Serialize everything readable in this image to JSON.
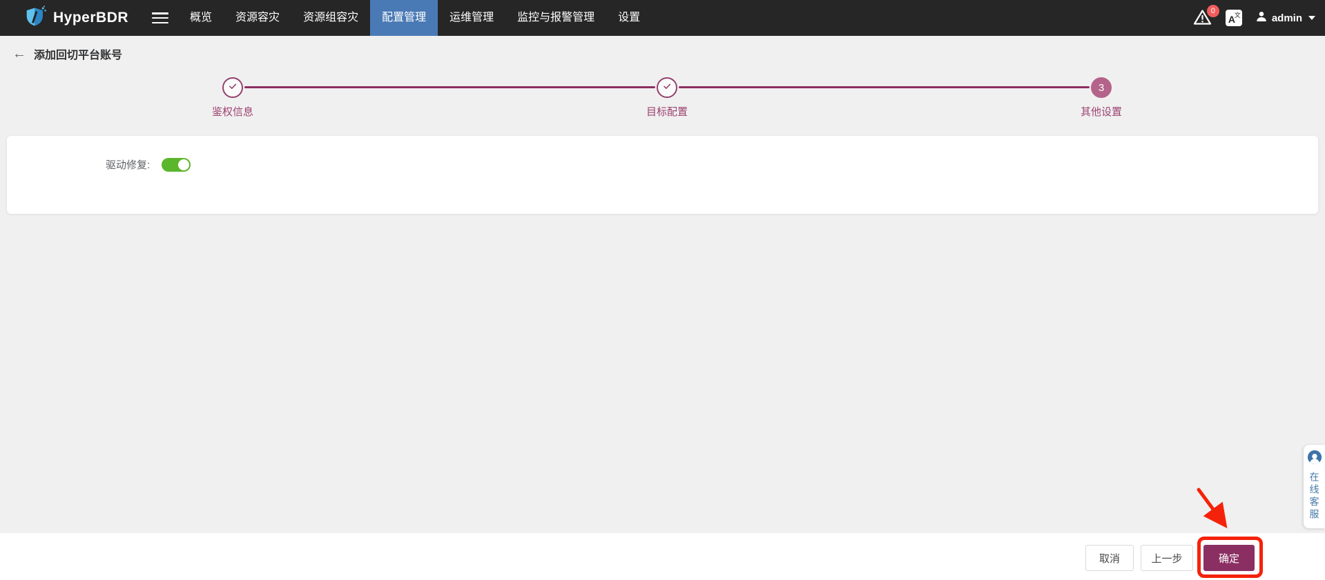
{
  "navbar": {
    "brand": "HyperBDR",
    "items": [
      {
        "label": "概览",
        "active": false
      },
      {
        "label": "资源容灾",
        "active": false
      },
      {
        "label": "资源组容灾",
        "active": false
      },
      {
        "label": "配置管理",
        "active": true
      },
      {
        "label": "运维管理",
        "active": false
      },
      {
        "label": "监控与报警管理",
        "active": false
      },
      {
        "label": "设置",
        "active": false
      }
    ],
    "alert_badge": "0",
    "language_primary": "A",
    "language_secondary": "文",
    "username": "admin"
  },
  "page": {
    "back_arrow": "←",
    "title": "添加回切平台账号"
  },
  "stepper": {
    "steps": [
      {
        "label": "鉴权信息",
        "status": "completed"
      },
      {
        "label": "目标配置",
        "status": "completed"
      },
      {
        "label": "其他设置",
        "status": "current",
        "number": "3"
      }
    ]
  },
  "content": {
    "driver_repair_label": "驱动修复:",
    "driver_repair_state": "on"
  },
  "footer": {
    "cancel_label": "取消",
    "previous_label": "上一步",
    "confirm_label": "确定"
  },
  "support": {
    "label": "在线客服"
  },
  "colors": {
    "navbar_bg": "#262626",
    "active_tab": "#4a7ab5",
    "badge_red": "#f25c5c",
    "stepper_accent": "#8c2e5f",
    "stepper_current_fill": "#b4638a",
    "toggle_on_green": "#5cb62b",
    "confirm_button": "#8b2f63",
    "annotation_red": "#f5220b",
    "support_blue": "#4779a8"
  }
}
